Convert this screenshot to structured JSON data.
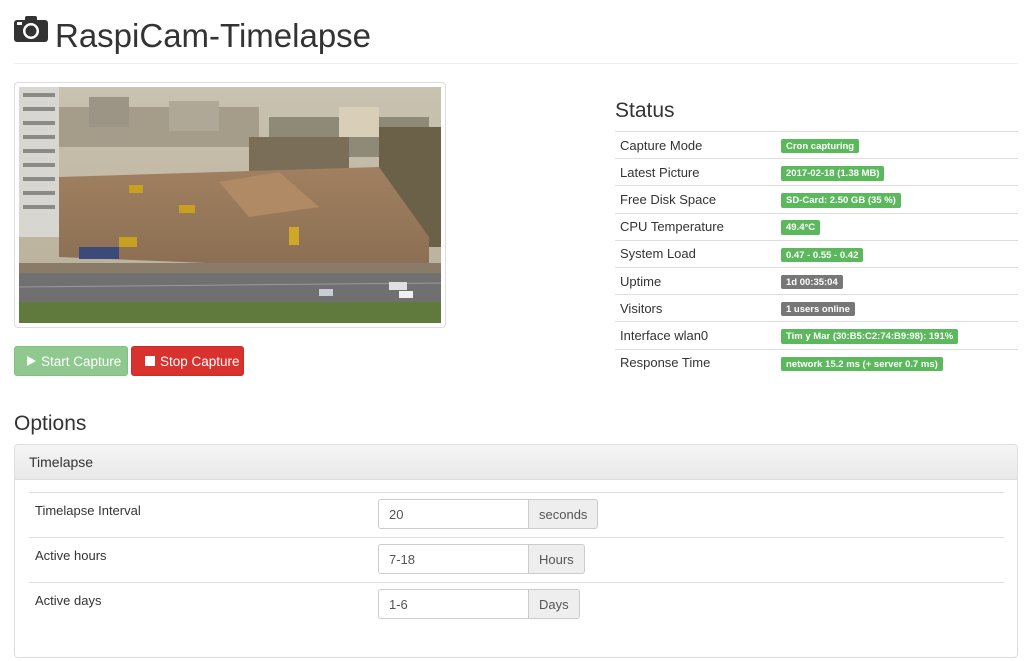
{
  "app": {
    "title": "RaspiCam-Timelapse",
    "icon": "camera-icon"
  },
  "preview": {
    "alt": "Timelapse preview of construction site"
  },
  "controls": {
    "start_label": "Start Capture",
    "stop_label": "Stop Capture",
    "start_icon": "play-icon",
    "stop_icon": "stop-icon"
  },
  "status": {
    "title": "Status",
    "rows": [
      {
        "label": "Capture Mode",
        "value": "Cron capturing",
        "kind": "success"
      },
      {
        "label": "Latest Picture",
        "value": "2017-02-18 (1.38 MB)",
        "kind": "success"
      },
      {
        "label": "Free Disk Space",
        "value": "SD-Card: 2.50 GB (35 %)",
        "kind": "success"
      },
      {
        "label": "CPU Temperature",
        "value": "49.4°C",
        "kind": "success"
      },
      {
        "label": "System Load",
        "value": "0.47 - 0.55 - 0.42",
        "kind": "success"
      },
      {
        "label": "Uptime",
        "value": "1d 00:35:04",
        "kind": "default"
      },
      {
        "label": "Visitors",
        "value": "1 users online",
        "kind": "default"
      },
      {
        "label": "Interface wlan0",
        "value": "Tim y Mar (30:B5:C2:74:B9:98): 191%",
        "kind": "success"
      },
      {
        "label": "Response Time",
        "value": "network 15.2 ms (+ server 0.7 ms)",
        "kind": "success"
      }
    ]
  },
  "options": {
    "title": "Options",
    "panel_title": "Timelapse",
    "rows": [
      {
        "label": "Timelapse Interval",
        "value": "20",
        "unit": "seconds"
      },
      {
        "label": "Active hours",
        "value": "7-18",
        "unit": "Hours"
      },
      {
        "label": "Active days",
        "value": "1-6",
        "unit": "Days"
      }
    ]
  },
  "colors": {
    "success": "#5cb85c",
    "default": "#777777",
    "start_button": "#8fc98f",
    "stop_button": "#d9312d"
  }
}
